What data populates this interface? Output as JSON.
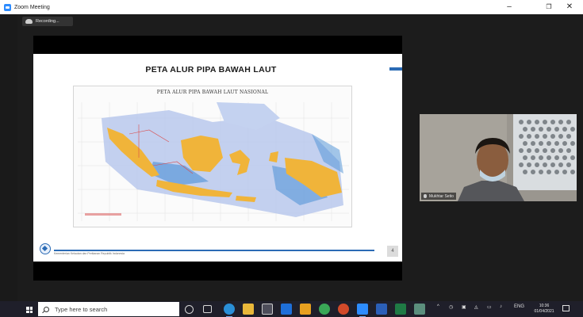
{
  "window": {
    "title": "Zoom Meeting",
    "minimize": "–",
    "restore": "❐",
    "close": "✕"
  },
  "recording": {
    "label": "Recording..."
  },
  "slide": {
    "title": "PETA ALUR PIPA BAWAH LAUT",
    "map_title": "PETA ALUR PIPA BAWAH LAUT NASIONAL",
    "footer_text": "Kementerian Kelautan dan Perikanan Republik Indonesia",
    "page_indicator": "4"
  },
  "participant": {
    "name": "Mukhtar Setio"
  },
  "taskbar": {
    "search_placeholder": "Type here to search",
    "language": "ENG",
    "time": "10:36",
    "date": "01/04/2021"
  },
  "colors": {
    "accent": "#2b6bb5",
    "land": "#f0b43a",
    "sea_shallow": "#b8c8ec",
    "sea_deep": "#4a8fd6"
  }
}
